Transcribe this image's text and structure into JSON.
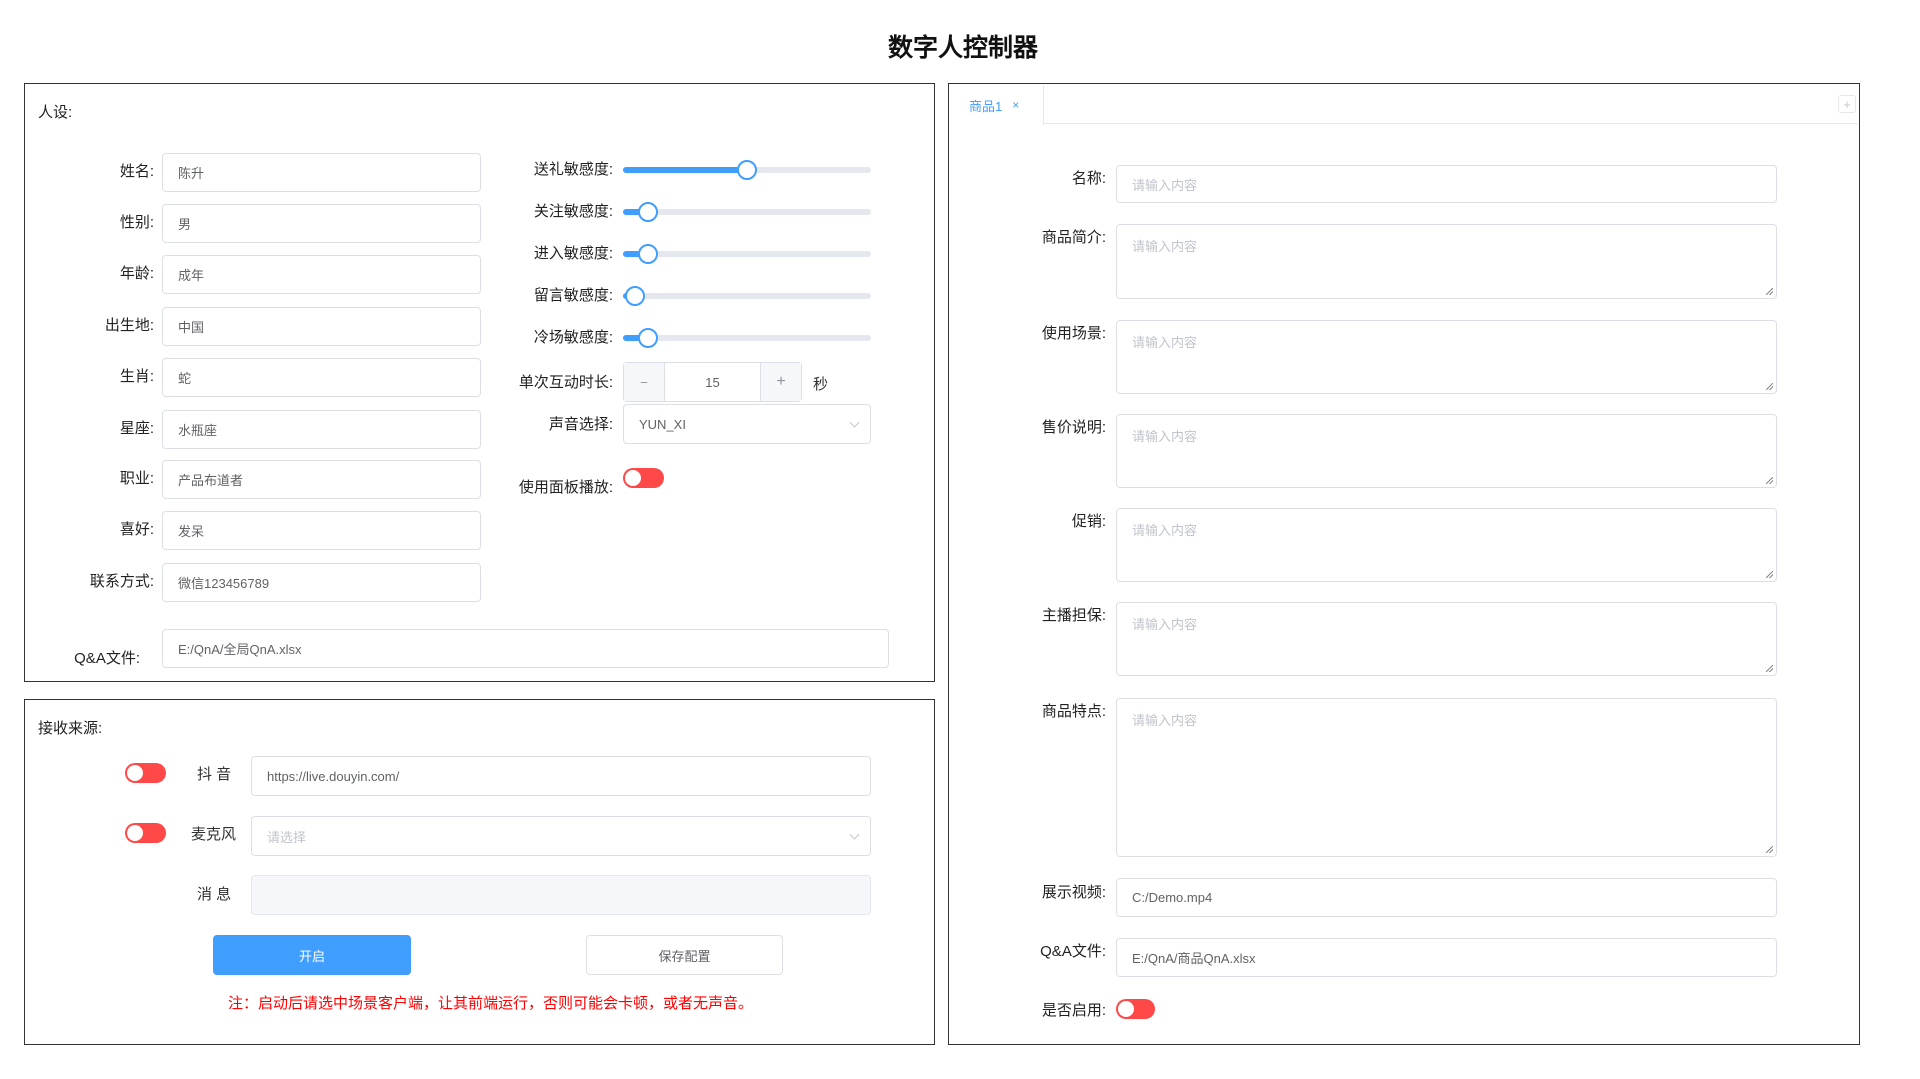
{
  "title": "数字人控制器",
  "persona": {
    "section_label": "人设:",
    "fields": [
      {
        "label": "姓名:",
        "value": "陈升"
      },
      {
        "label": "性别:",
        "value": "男"
      },
      {
        "label": "年龄:",
        "value": "成年"
      },
      {
        "label": "出生地:",
        "value": "中国"
      },
      {
        "label": "生肖:",
        "value": "蛇"
      },
      {
        "label": "星座:",
        "value": "水瓶座"
      },
      {
        "label": "职业:",
        "value": "产品布道者"
      },
      {
        "label": "喜好:",
        "value": "发呆"
      },
      {
        "label": "联系方式:",
        "value": "微信123456789"
      }
    ],
    "sliders": [
      {
        "label": "送礼敏感度:",
        "value": 50
      },
      {
        "label": "关注敏感度:",
        "value": 10
      },
      {
        "label": "进入敏感度:",
        "value": 10
      },
      {
        "label": "留言敏感度:",
        "value": 5
      },
      {
        "label": "冷场敏感度:",
        "value": 10
      }
    ],
    "duration": {
      "label": "单次互动时长:",
      "value": "15",
      "minus": "−",
      "plus": "+",
      "unit": "秒"
    },
    "voice": {
      "label": "声音选择:",
      "value": "YUN_XI"
    },
    "panel_play": {
      "label": "使用面板播放:",
      "on": false
    },
    "qa": {
      "label": "Q&A文件:",
      "value": "E:/QnA/全局QnA.xlsx"
    }
  },
  "source": {
    "section_label": "接收来源:",
    "douyin": {
      "label": "抖 音",
      "value": "https://live.douyin.com/",
      "on": false
    },
    "mic": {
      "label": "麦克风",
      "placeholder": "请选择",
      "on": false
    },
    "message": {
      "label": "消 息",
      "value": ""
    },
    "start_button": "开启",
    "save_button": "保存配置",
    "note": "注：启动后请选中场景客户端，让其前端运行，否则可能会卡顿，或者无声音。"
  },
  "product": {
    "tab_label": "商品1",
    "tab_close": "×",
    "add_tab": "+",
    "placeholder": "请输入内容",
    "fields": [
      {
        "label": "名称:"
      },
      {
        "label": "商品简介:"
      },
      {
        "label": "使用场景:"
      },
      {
        "label": "售价说明:"
      },
      {
        "label": "促销:"
      },
      {
        "label": "主播担保:"
      },
      {
        "label": "商品特点:"
      }
    ],
    "video": {
      "label": "展示视频:",
      "value": "C:/Demo.mp4"
    },
    "qa": {
      "label": "Q&A文件:",
      "value": "E:/QnA/商品QnA.xlsx"
    },
    "enabled": {
      "label": "是否启用:",
      "on": false
    }
  },
  "colors": {
    "primary": "#409eff",
    "toggle_off": "#ff4949",
    "note": "#ff0000"
  }
}
